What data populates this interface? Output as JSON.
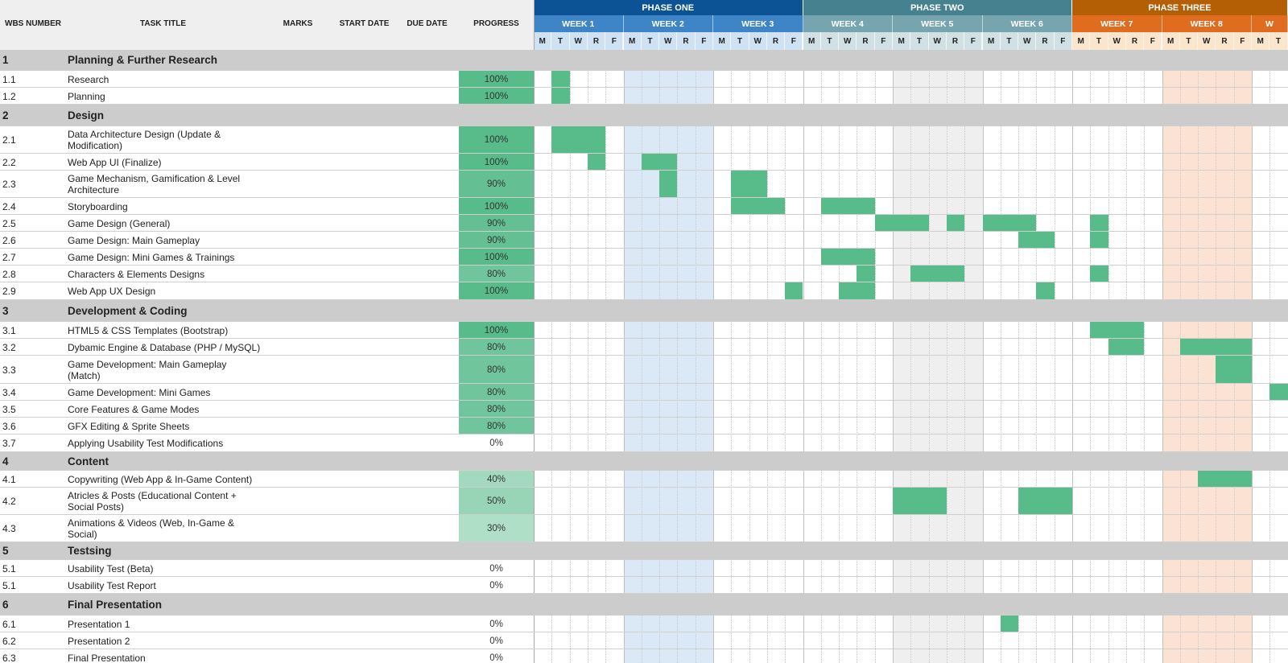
{
  "headers": {
    "wbs": "WBS NUMBER",
    "task_title": "TASK TITLE",
    "marks": "MARKS",
    "start_date": "START DATE",
    "due_date": "DUE DATE",
    "progress": "PROGRESS"
  },
  "phases": [
    {
      "label": "PHASE ONE",
      "color": "#0b5394"
    },
    {
      "label": "PHASE TWO",
      "color": "#45818e"
    },
    {
      "label": "PHASE THREE",
      "color": "#b45f06"
    }
  ],
  "weeks": [
    "WEEK 1",
    "WEEK 2",
    "WEEK 3",
    "WEEK 4",
    "WEEK 5",
    "WEEK 6",
    "WEEK 7",
    "WEEK 8",
    "W"
  ],
  "days": [
    "M",
    "T",
    "W",
    "R",
    "F"
  ],
  "colors": {
    "bar": "#57bb8a",
    "section_row": "#cccccc",
    "header_gray": "#efefef",
    "phase1_week": "#3d85c6",
    "phase1_day": "#cfe2f3",
    "phase1_band": "#dbe9f7",
    "phase2_week": "#76a5af",
    "phase2_day": "#d0e0e3",
    "phase2_band": "#efefef",
    "phase3_week": "#e06d1f",
    "phase3_day": "#fce5cd",
    "phase3_band": "#fbe2d3"
  },
  "rows": [
    {
      "type": "section",
      "wbs": "1",
      "title": "Planning & Further Research",
      "progress": "",
      "bars": []
    },
    {
      "type": "task",
      "wbs": "1.1",
      "title": "Research",
      "progress": "100%",
      "progress_value": 100,
      "bars": [
        1
      ]
    },
    {
      "type": "task",
      "wbs": "1.2",
      "title": "Planning",
      "progress": "100%",
      "progress_value": 100,
      "bars": [
        1
      ]
    },
    {
      "type": "section",
      "wbs": "2",
      "title": "Design",
      "progress": "",
      "bars": []
    },
    {
      "type": "task",
      "wbs": "2.1",
      "title": "Data Architecture Design (Update & Modification)",
      "progress": "100%",
      "progress_value": 100,
      "bars": [
        1,
        2,
        3
      ]
    },
    {
      "type": "task",
      "wbs": "2.2",
      "title": "Web App UI (Finalize)",
      "progress": "100%",
      "progress_value": 100,
      "bars": [
        3,
        6,
        7
      ]
    },
    {
      "type": "task",
      "wbs": "2.3",
      "title": "Game Mechanism, Gamification & Level Architecture",
      "progress": "90%",
      "progress_value": 90,
      "bars": [
        7,
        11,
        12
      ]
    },
    {
      "type": "task",
      "wbs": "2.4",
      "title": "Storyboarding",
      "progress": "100%",
      "progress_value": 100,
      "bars": [
        11,
        12,
        13,
        16,
        17,
        18
      ]
    },
    {
      "type": "task",
      "wbs": "2.5",
      "title": "Game Design (General)",
      "progress": "90%",
      "progress_value": 90,
      "bars": [
        19,
        20,
        21,
        23,
        25,
        26,
        27,
        31
      ]
    },
    {
      "type": "task",
      "wbs": "2.6",
      "title": "Game Design: Main Gameplay",
      "progress": "90%",
      "progress_value": 90,
      "bars": [
        27,
        28,
        31
      ]
    },
    {
      "type": "task",
      "wbs": "2.7",
      "title": "Game Design: Mini Games & Trainings",
      "progress": "100%",
      "progress_value": 100,
      "bars": [
        16,
        17,
        18
      ]
    },
    {
      "type": "task",
      "wbs": "2.8",
      "title": "Characters & Elements Designs",
      "progress": "80%",
      "progress_value": 80,
      "bars": [
        18,
        21,
        22,
        23,
        31
      ]
    },
    {
      "type": "task",
      "wbs": "2.9",
      "title": "Web App UX Design",
      "progress": "100%",
      "progress_value": 100,
      "bars": [
        14,
        17,
        18,
        28
      ]
    },
    {
      "type": "section",
      "wbs": "3",
      "title": "Development & Coding",
      "progress": "",
      "bars": []
    },
    {
      "type": "task",
      "wbs": "3.1",
      "title": "HTML5 & CSS Templates (Bootstrap)",
      "progress": "100%",
      "progress_value": 100,
      "bars": [
        31,
        32,
        33
      ]
    },
    {
      "type": "task",
      "wbs": "3.2",
      "title": "Dybamic Engine & Database (PHP / MySQL)",
      "progress": "80%",
      "progress_value": 80,
      "bars": [
        32,
        33,
        36,
        37,
        38,
        39
      ]
    },
    {
      "type": "task",
      "wbs": "3.3",
      "title": "Game Development: Main Gameplay (Match)",
      "progress": "80%",
      "progress_value": 80,
      "bars": [
        38,
        39
      ]
    },
    {
      "type": "task",
      "wbs": "3.4",
      "title": "Game Development: Mini Games",
      "progress": "80%",
      "progress_value": 80,
      "bars": [
        41
      ]
    },
    {
      "type": "task",
      "wbs": "3.5",
      "title": "Core Features & Game Modes",
      "progress": "80%",
      "progress_value": 80,
      "bars": []
    },
    {
      "type": "task",
      "wbs": "3.6",
      "title": "GFX Editing & Sprite Sheets",
      "progress": "80%",
      "progress_value": 80,
      "bars": []
    },
    {
      "type": "task",
      "wbs": "3.7",
      "title": "Applying Usability Test Modifications",
      "progress": "0%",
      "progress_value": 0,
      "bars": []
    },
    {
      "type": "section",
      "wbs": "4",
      "title": "Content",
      "progress": "",
      "bars": []
    },
    {
      "type": "task",
      "wbs": "4.1",
      "title": "Copywriting (Web App & In-Game Content)",
      "progress": "40%",
      "progress_value": 40,
      "bars": [
        37,
        38,
        39
      ]
    },
    {
      "type": "task",
      "wbs": "4.2",
      "title": "Atricles & Posts (Educational Content + Social Posts)",
      "progress": "50%",
      "progress_value": 50,
      "bars": [
        20,
        21,
        22,
        27,
        28,
        29
      ]
    },
    {
      "type": "task",
      "wbs": "4.3",
      "title": "Animations & Videos (Web, In-Game & Social)",
      "progress": "30%",
      "progress_value": 30,
      "bars": []
    },
    {
      "type": "section",
      "wbs": "5",
      "title": "Testsing",
      "progress": "",
      "bars": []
    },
    {
      "type": "task",
      "wbs": "5.1",
      "title": "Usability Test (Beta)",
      "progress": "0%",
      "progress_value": 0,
      "bars": []
    },
    {
      "type": "task",
      "wbs": "5.1",
      "title": "Usability Test Report",
      "progress": "0%",
      "progress_value": 0,
      "bars": []
    },
    {
      "type": "section",
      "wbs": "6",
      "title": "Final Presentation",
      "progress": "",
      "bars": []
    },
    {
      "type": "task",
      "wbs": "6.1",
      "title": "Presentation 1",
      "progress": "0%",
      "progress_value": 0,
      "bars": [
        26
      ]
    },
    {
      "type": "task",
      "wbs": "6.2",
      "title": "Presentation 2",
      "progress": "0%",
      "progress_value": 0,
      "bars": []
    },
    {
      "type": "task",
      "wbs": "6.3",
      "title": "Final Presentation",
      "progress": "0%",
      "progress_value": 0,
      "bars": []
    }
  ]
}
